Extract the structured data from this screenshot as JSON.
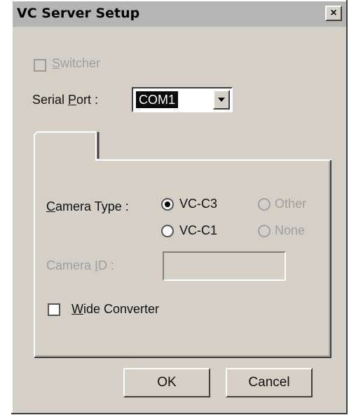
{
  "window": {
    "title": "VC Server Setup",
    "close_glyph": "×"
  },
  "switcher": {
    "prefix": "",
    "accel": "S",
    "rest": "witcher",
    "checked": false,
    "enabled": false
  },
  "serial_port": {
    "prefix": "Serial ",
    "accel": "P",
    "rest": "ort :",
    "value": "COM1"
  },
  "camera_type": {
    "prefix": "",
    "accel": "C",
    "rest": "amera Type :",
    "options": [
      {
        "label": "VC-C3",
        "selected": true,
        "enabled": true
      },
      {
        "label": "Other",
        "selected": false,
        "enabled": false
      },
      {
        "label": "VC-C1",
        "selected": false,
        "enabled": true
      },
      {
        "label": "None",
        "selected": false,
        "enabled": false
      }
    ]
  },
  "camera_id": {
    "prefix": "Camera ",
    "accel": "I",
    "rest": "D :",
    "value": "",
    "enabled": false
  },
  "wide_converter": {
    "prefix": "",
    "accel": "W",
    "rest": "ide Converter",
    "checked": false
  },
  "buttons": {
    "ok": "OK",
    "cancel": "Cancel"
  }
}
